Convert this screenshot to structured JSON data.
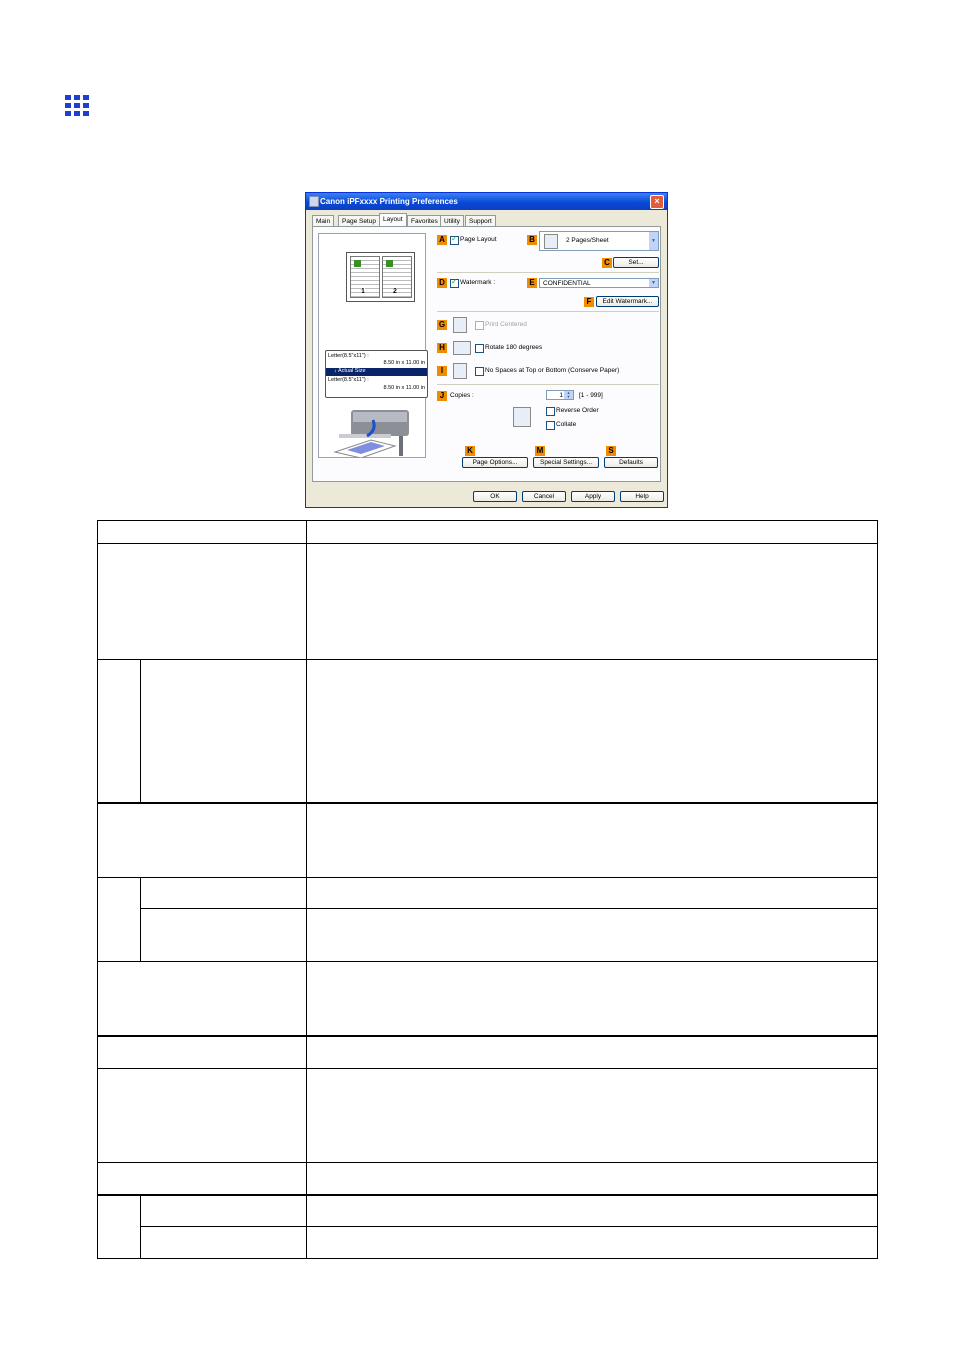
{
  "dialog": {
    "title": "Canon iPFxxxx Printing Preferences",
    "close_glyph": "×",
    "tabs": [
      "Main",
      "Page Setup",
      "Layout",
      "Favorites",
      "Utility",
      "Support"
    ],
    "active_tab": "Layout",
    "preview": {
      "page1": "1",
      "page2": "2",
      "size_line1": "Letter(8.5\"x11\") :",
      "size_line1_dim": "8.50 in x 11.00 in",
      "actual_size": "Actual Size",
      "size_line2": "Letter(8.5\"x11\") :",
      "size_line2_dim": "8.50 in x 11.00 in",
      "arrow_glyph": "↓"
    },
    "labels": {
      "A": "A",
      "B": "B",
      "C": "C",
      "D": "D",
      "E": "E",
      "F": "F",
      "G": "G",
      "H": "H",
      "I": "I",
      "J": "J",
      "K": "K",
      "M": "M",
      "S": "S"
    },
    "page_layout": {
      "label": "Page Layout",
      "checked": true
    },
    "pages_per_sheet": {
      "value": "2 Pages/Sheet"
    },
    "set_button": "Set...",
    "watermark": {
      "label": "Watermark :",
      "checked": true
    },
    "watermark_select": {
      "value": "CONFIDENTIAL"
    },
    "edit_watermark_button": "Edit Watermark...",
    "print_centered": {
      "label": "Print Centered",
      "checked": false,
      "enabled": false
    },
    "rotate": {
      "label": "Rotate 180 degrees",
      "checked": false
    },
    "no_spaces": {
      "label": "No Spaces at Top or Bottom (Conserve Paper)",
      "checked": false
    },
    "copies": {
      "label": "Copies :",
      "value": "1",
      "range": "[1 - 999]"
    },
    "reverse_order": {
      "label": "Reverse Order",
      "checked": false
    },
    "collate": {
      "label": "Collate",
      "checked": false
    },
    "page_options_button": "Page Options...",
    "special_settings_button": "Special Settings...",
    "defaults_button": "Defaults",
    "ok_button": "OK",
    "cancel_button": "Cancel",
    "apply_button": "Apply",
    "help_button": "Help",
    "arrow_down_glyph": "▼",
    "spin_up_glyph": "▲",
    "spin_down_glyph": "▼"
  },
  "colors": {
    "grid_icon": "#1f3fd0",
    "label_orange": "#f08c00",
    "titlebar": "#0a49d6"
  }
}
